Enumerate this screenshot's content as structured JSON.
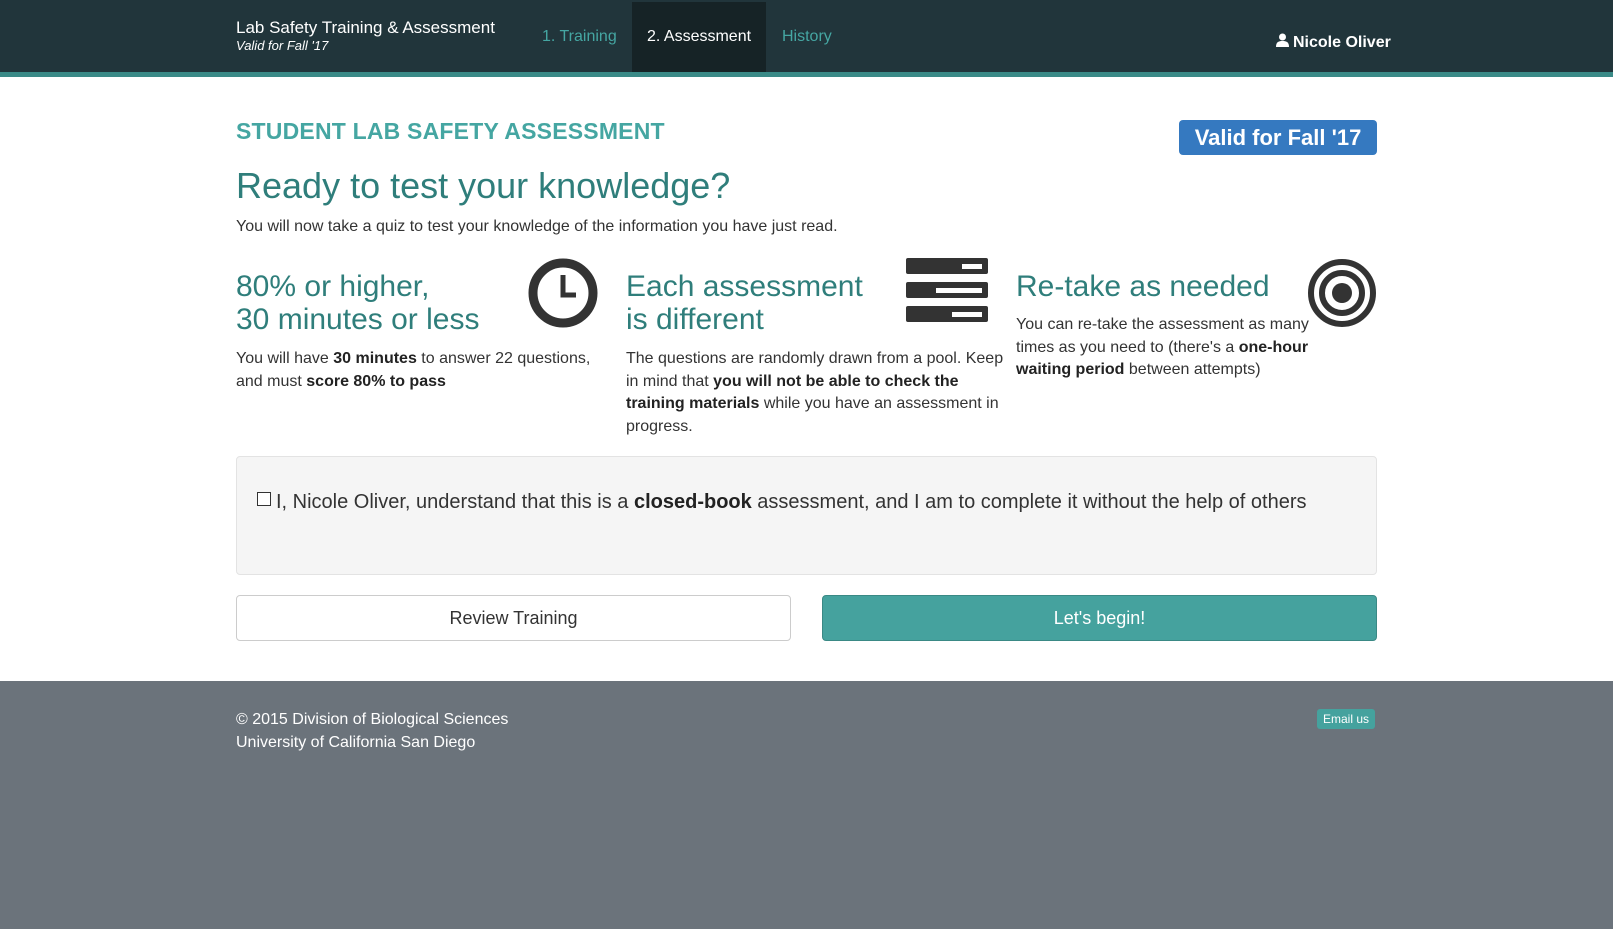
{
  "navbar": {
    "brand_title": "Lab Safety Training & Assessment",
    "brand_subtitle": "Valid for Fall '17",
    "items": [
      {
        "label": "1. Training"
      },
      {
        "label": "2. Assessment"
      },
      {
        "label": "History"
      }
    ],
    "active_item": "2. Assessment",
    "user_name": "Nicole Oliver"
  },
  "header": {
    "section_title": "STUDENT LAB SAFETY ASSESSMENT",
    "valid_badge": "Valid for Fall '17",
    "headline": "Ready to test your knowledge?",
    "intro": "You will now take a quiz to test your knowledge of the information you have just read."
  },
  "features": [
    {
      "title_line1": "80% or higher,",
      "title_line2": "30 minutes or less",
      "icon": "clock-icon",
      "t1": "You will have ",
      "b1": "30 minutes",
      "t2": " to answer 22 questions, and must ",
      "b2": "score 80% to pass",
      "t3": ""
    },
    {
      "title_line1": "Each assessment",
      "title_line2": "is different",
      "icon": "server-stack-icon",
      "t1": "The questions are randomly drawn from a pool. Keep in mind that ",
      "b1": "you will not be able to check the training materials",
      "t2": " while you have an assessment in progress.",
      "b2": "",
      "t3": ""
    },
    {
      "title_line1": "Re-take as needed",
      "title_line2": "",
      "icon": "target-icon",
      "t1": "You can re-take the assessment as many times as you need to (there's a ",
      "b1": "one-hour waiting period",
      "t2": " between attempts)",
      "b2": "",
      "t3": ""
    }
  ],
  "acknowledgement": {
    "checked": false,
    "text_before": "I, Nicole Oliver, understand that this is a ",
    "text_bold": "closed-book",
    "text_after": " assessment, and I am to complete it without the help of others"
  },
  "buttons": {
    "review_label": "Review Training",
    "begin_label": "Let's begin!"
  },
  "footer": {
    "line1": "© 2015 Division of Biological Sciences",
    "line2": "University of California San Diego",
    "email_label": "Email us"
  },
  "colors": {
    "navbar_bg": "#21353b",
    "accent_teal": "#45a29e",
    "heading_teal": "#2f7e7b",
    "badge_blue": "#3579c0",
    "footer_bg": "#6b737b"
  }
}
